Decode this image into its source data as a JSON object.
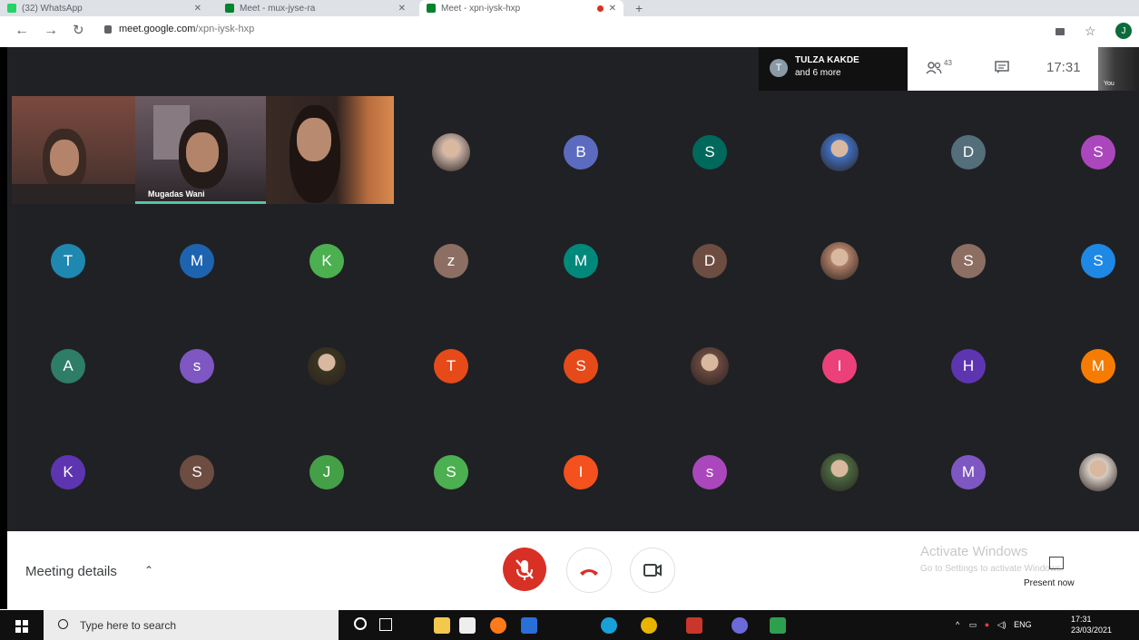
{
  "browser": {
    "tabs": [
      {
        "title": "(32) WhatsApp",
        "favicon_color": "#25d366"
      },
      {
        "title": "Meet - mux-jyse-ra",
        "favicon_color": "#00832d"
      },
      {
        "title": "Meet - xpn-iysk-hxp",
        "favicon_color": "#00832d"
      }
    ],
    "new_tab_label": "+",
    "url_host": "meet.google.com",
    "url_path": "/xpn-iysk-hxp",
    "profile_initial": "J"
  },
  "meet": {
    "speaker_initial": "T",
    "speaker_name": "TULZA KAKDE",
    "speaker_more": "and 6 more",
    "participant_count": "43",
    "time": "17:31",
    "self_label": "You",
    "video_tiles": [
      {
        "label": ""
      },
      {
        "label": "Mugadas Wani"
      },
      {
        "label": ""
      }
    ],
    "grid_rows": [
      [
        {
          "type": "photo",
          "bg": "#c9b2a4"
        },
        {
          "type": "initial",
          "letter": "B",
          "color": "#5c6bc0"
        },
        {
          "type": "initial",
          "letter": "S",
          "color": "#00695c"
        },
        {
          "type": "photo",
          "bg": "#3f6fc0"
        },
        {
          "type": "initial",
          "letter": "D",
          "color": "#546e7a"
        },
        {
          "type": "initial",
          "letter": "S",
          "color": "#ab47bc"
        }
      ],
      [
        {
          "type": "initial",
          "letter": "T",
          "color": "#1e88b0"
        },
        {
          "type": "initial",
          "letter": "M",
          "color": "#1e63b0"
        },
        {
          "type": "initial",
          "letter": "K",
          "color": "#4caf50"
        },
        {
          "type": "initial",
          "letter": "z",
          "color": "#8d6e63"
        },
        {
          "type": "initial",
          "letter": "M",
          "color": "#00897b"
        },
        {
          "type": "initial",
          "letter": "D",
          "color": "#6d4c41"
        },
        {
          "type": "photo",
          "bg": "#b08068"
        },
        {
          "type": "initial",
          "letter": "S",
          "color": "#8d6e63"
        },
        {
          "type": "initial",
          "letter": "S",
          "color": "#1e88e5"
        }
      ],
      [
        {
          "type": "initial",
          "letter": "A",
          "color": "#2e7d67"
        },
        {
          "type": "initial",
          "letter": "s",
          "color": "#7e57c2"
        },
        {
          "type": "photo",
          "bg": "#3a3520"
        },
        {
          "type": "initial",
          "letter": "T",
          "color": "#e64a19"
        },
        {
          "type": "initial",
          "letter": "S",
          "color": "#e64a19"
        },
        {
          "type": "photo",
          "bg": "#6a4a40"
        },
        {
          "type": "initial",
          "letter": "I",
          "color": "#ec407a"
        },
        {
          "type": "initial",
          "letter": "H",
          "color": "#5e35b1"
        },
        {
          "type": "initial",
          "letter": "M",
          "color": "#f57c00"
        }
      ],
      [
        {
          "type": "initial",
          "letter": "K",
          "color": "#5e35b1"
        },
        {
          "type": "initial",
          "letter": "S",
          "color": "#6d4c41"
        },
        {
          "type": "initial",
          "letter": "J",
          "color": "#43a047"
        },
        {
          "type": "initial",
          "letter": "S",
          "color": "#4caf50"
        },
        {
          "type": "initial",
          "letter": "I",
          "color": "#f4511e"
        },
        {
          "type": "initial",
          "letter": "s",
          "color": "#ab47bc"
        },
        {
          "type": "photo",
          "bg": "#4a6a40"
        },
        {
          "type": "initial",
          "letter": "M",
          "color": "#7e57c2"
        },
        {
          "type": "photo",
          "bg": "#d8cfc6"
        }
      ]
    ],
    "meeting_details_label": "Meeting details",
    "present_label": "Present now",
    "mic_color": "#d93025"
  },
  "watermark": {
    "line1": "Activate Windows",
    "line2": "Go to Settings to activate Windows."
  },
  "taskbar": {
    "search_placeholder": "Type here to search",
    "lang": "ENG",
    "time": "17:31",
    "date": "23/03/2021"
  }
}
